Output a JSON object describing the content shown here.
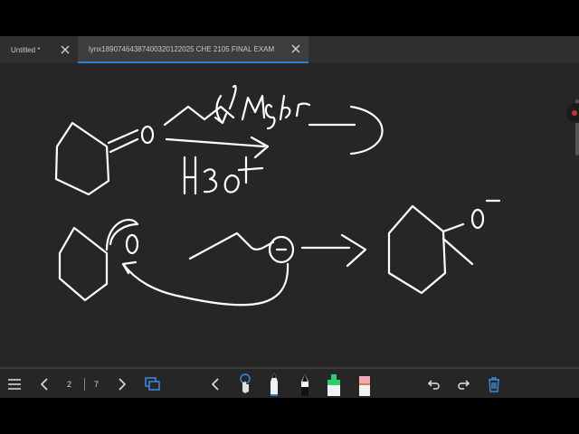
{
  "tabs": [
    {
      "label": "Untitled *",
      "active": false
    },
    {
      "label": "lynx18907464387400320122025 CHE 2105 FINAL EXAM",
      "active": true
    }
  ],
  "toolbar": {
    "menu_icon": "hamburger-menu-icon",
    "current_page": "2",
    "total_pages": "7",
    "tools": [
      "lasso-pointer-icon",
      "pen-white-icon",
      "pen-black-icon",
      "highlighter-green-icon",
      "eraser-pink-icon"
    ],
    "undo_icon": "undo-icon",
    "redo_icon": "redo-icon",
    "trash_icon": "trash-icon"
  },
  "colors": {
    "canvas_bg": "#262626",
    "ink": "#ffffff",
    "active_tab_accent": "#2f7fd6",
    "highlighter": "#2ecc71",
    "eraser": "#f4a6c0"
  }
}
